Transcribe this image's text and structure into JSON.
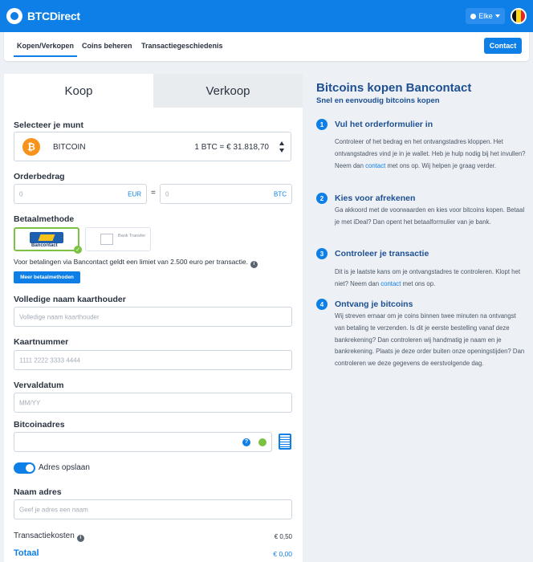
{
  "brand": {
    "logo": "BTCDirect",
    "accent": "#0d7fe6"
  },
  "user_menu": {
    "label": "Elke",
    "icon": "user-icon"
  },
  "language_flag": {
    "colors": [
      "#111111",
      "#fbd918",
      "#e6262d"
    ]
  },
  "nav": {
    "tabs": [
      "Kopen/Verkopen",
      "Coins beheren",
      "Transactiegeschiedenis"
    ],
    "contact": "Contact"
  },
  "order": {
    "tab_buy": "Koop",
    "tab_sell": "Verkoop",
    "coin_label": "Selecteer je munt",
    "coin_name": "BITCOIN",
    "coin_symbol": "₿",
    "coin_rate": "1 BTC  =  € 31.818,70",
    "amount_label": "Orderbedrag",
    "eur_placeholder": "0",
    "eur_unit": "EUR",
    "equals": "=",
    "btc_placeholder": "0",
    "btc_unit": "BTC",
    "payment_label": "Betaalmethode",
    "payment_bancontact": "Bancontact",
    "payment_bank": "Bank Transfer",
    "payment_limit_text": "Voor betalingen via Bancontact geldt een limiet van 2.500 euro per transactie.",
    "more_methods": "Meer betaalmethoden",
    "cardholder_label": "Volledige naam kaarthouder",
    "cardholder_placeholder": "Volledige naam kaarthouder",
    "cardnumber_label": "Kaartnummer",
    "cardnumber_placeholder": "1111 2222 3333 4444",
    "expiry_label": "Vervaldatum",
    "expiry_placeholder": "MM/YY",
    "address_label": "Bitcoinadres",
    "address_value": "",
    "save_address_label": "Adres opslaan",
    "save_address_on": true,
    "address_name_label": "Naam adres",
    "address_name_placeholder": "Geef je adres een naam",
    "fee_label": "Transactiekosten",
    "fee_value": "€ 0,50",
    "total_label": "Totaal",
    "total_value": "€ 0,00"
  },
  "sidebar": {
    "title": "Bitcoins kopen Bancontact",
    "subtitle": "Snel en eenvoudig bitcoins kopen",
    "steps": [
      {
        "num": "1",
        "title": "Vul het orderformulier in",
        "text_before": "Controleer of het bedrag en het ontvangstadres kloppen. Het ontvangstadres vind je in je wallet. Heb je hulp nodig bij het invullen? Neem dan ",
        "link": "contact",
        "text_after": " met ons op. Wij helpen je graag verder."
      },
      {
        "num": "2",
        "title": "Kies voor afrekenen",
        "text_before": "Ga akkoord met de voorwaarden en kies voor bitcoins kopen. Betaal je met iDeal? Dan opent het betaalformulier van je bank.",
        "link": "",
        "text_after": ""
      },
      {
        "num": "3",
        "title": "Controleer je transactie",
        "text_before": "Dit is je laatste kans om je ontvangstadres te controleren. Klopt het niet? Neem dan ",
        "link": "contact",
        "text_after": " met ons op."
      },
      {
        "num": "4",
        "title": "Ontvang je bitcoins",
        "text_before": "Wij streven ernaar om je coins binnen twee minuten na ontvangst van betaling te verzenden. Is dit je eerste bestelling vanaf deze bankrekening? Dan controleren wij handmatig je naam en je bankrekening. Plaats je deze order buiten onze openingstijden? Dan controleren we deze gegevens de eerstvolgende dag.",
        "link": "",
        "text_after": ""
      }
    ]
  }
}
